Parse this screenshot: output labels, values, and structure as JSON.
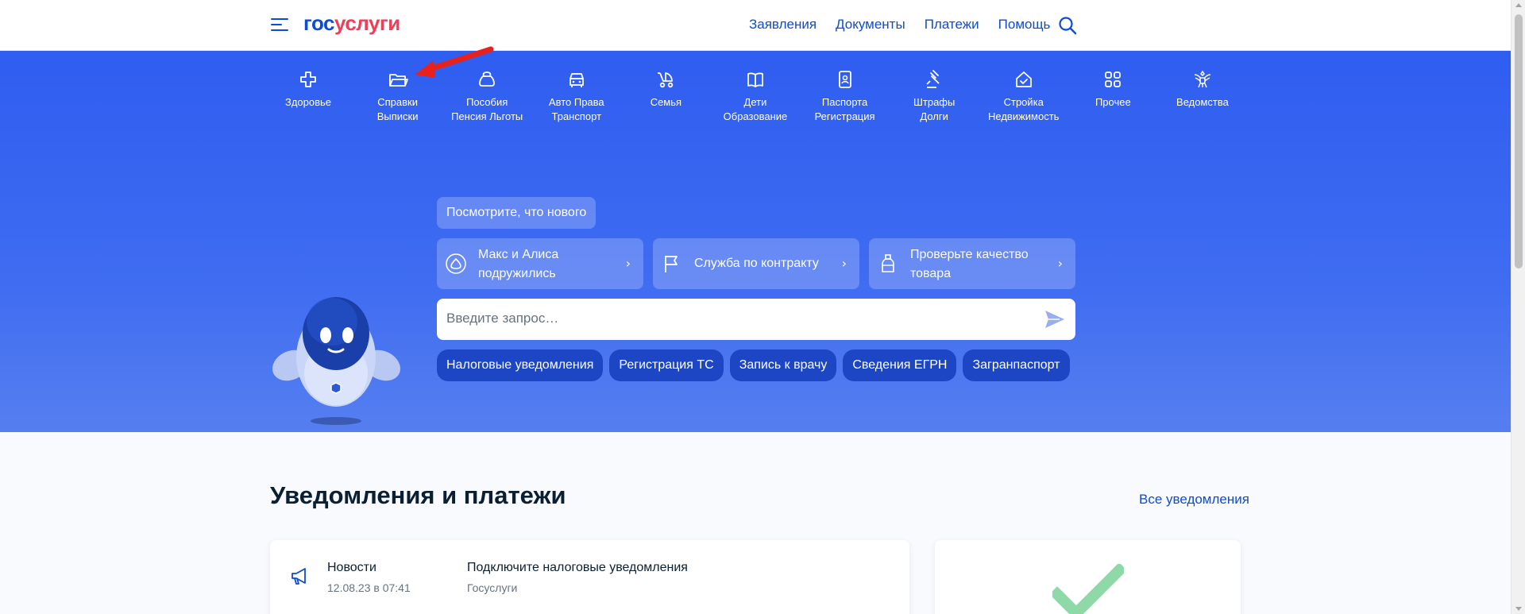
{
  "header": {
    "logo_part1": "гос",
    "logo_part2": "услуги",
    "nav": [
      "Заявления",
      "Документы",
      "Платежи",
      "Помощь"
    ]
  },
  "categories": [
    {
      "label": "Здоровье",
      "icon": "health-cross-icon"
    },
    {
      "label": "Справки\nВыписки",
      "icon": "folder-icon"
    },
    {
      "label": "Пособия\nПенсия Льготы",
      "icon": "money-bag-icon"
    },
    {
      "label": "Авто Права\nТранспорт",
      "icon": "car-icon"
    },
    {
      "label": "Семья",
      "icon": "stroller-icon"
    },
    {
      "label": "Дети\nОбразование",
      "icon": "book-icon"
    },
    {
      "label": "Паспорта\nРегистрация",
      "icon": "passport-icon"
    },
    {
      "label": "Штрафы\nДолги",
      "icon": "gavel-icon"
    },
    {
      "label": "Стройка\nНедвижимость",
      "icon": "house-icon"
    },
    {
      "label": "Прочее",
      "icon": "grid-icon"
    },
    {
      "label": "Ведомства",
      "icon": "eagle-emblem-icon"
    }
  ],
  "hero": {
    "news_chip": "Посмотрите, что нового",
    "promos": [
      {
        "text": "Макс и Алиса подружились",
        "icon": "alice-icon"
      },
      {
        "text": "Служба по контракту",
        "icon": "flag-icon"
      },
      {
        "text": "Проверьте качество товара",
        "icon": "bottle-icon"
      }
    ],
    "search_placeholder": "Введите запрос…",
    "quick_links": [
      "Налоговые уведомления",
      "Регистрация ТС",
      "Запись к врачу",
      "Сведения ЕГРН",
      "Загранпаспорт"
    ]
  },
  "notifications": {
    "title": "Уведомления и платежи",
    "all_link": "Все уведомления",
    "item": {
      "kind": "Новости",
      "date": "12.08.23 в 07:41",
      "title": "Подключите налоговые уведомления",
      "source": "Госуслуги"
    }
  },
  "colors": {
    "accent": "#0d4cd3",
    "brand_red": "#ee3f58",
    "hero_blue": "#2f5df0",
    "success_green": "#8fd9a8",
    "annotation_arrow": "#e8211d"
  }
}
